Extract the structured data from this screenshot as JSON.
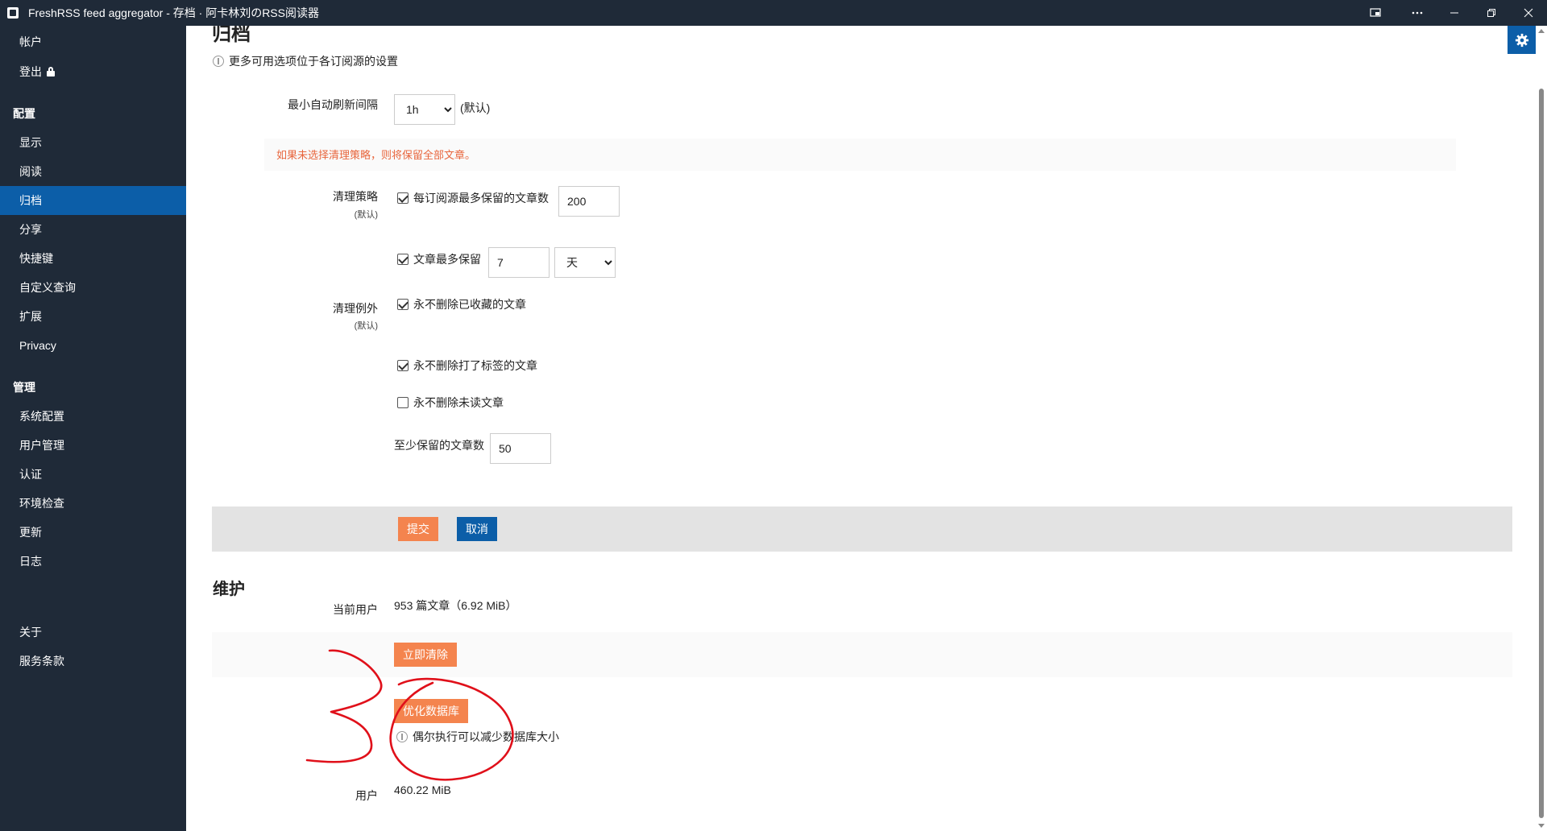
{
  "window": {
    "title": "FreshRSS feed aggregator - 存档 · 阿卡林刘のRSS阅读器"
  },
  "sidebar": {
    "account_items": [
      "帐户",
      "登出"
    ],
    "config_section": "配置",
    "config_items": [
      "显示",
      "阅读",
      "归档",
      "分享",
      "快捷键",
      "自定义查询",
      "扩展",
      "Privacy"
    ],
    "active_item": "归档",
    "admin_section": "管理",
    "admin_items": [
      "系统配置",
      "用户管理",
      "认证",
      "环境检查",
      "更新",
      "日志"
    ],
    "footer_items": [
      "关于",
      "服务条款"
    ]
  },
  "archive": {
    "heading": "归档",
    "more_options_hint": "更多可用选项位于各订阅源的设置",
    "refresh_label": "最小自动刷新间隔",
    "refresh_value": "1h",
    "refresh_default": "(默认)",
    "warning": "如果未选择清理策略，则将保留全部文章。",
    "cleanup_policy_label": "清理策略",
    "cleanup_policy_sub": "(默认)",
    "keep_max_label": "每订阅源最多保留的文章数",
    "keep_max_value": "200",
    "keep_max_checked": true,
    "keep_period_label": "文章最多保留",
    "keep_period_value": "7",
    "keep_period_unit": "天",
    "keep_period_checked": true,
    "exceptions_label": "清理例外",
    "exceptions_sub": "(默认)",
    "exception_favourites": "永不删除已收藏的文章",
    "exception_favourites_checked": true,
    "exception_labels": "永不删除打了标签的文章",
    "exception_labels_checked": true,
    "exception_unread": "永不删除未读文章",
    "exception_unread_checked": false,
    "min_keep_label": "至少保留的文章数",
    "min_keep_value": "50",
    "submit_label": "提交",
    "cancel_label": "取消"
  },
  "maintenance": {
    "heading": "维护",
    "current_user_label": "当前用户",
    "current_user_value": "953 篇文章（6.92 MiB）",
    "purge_label": "立即清除",
    "optimize_label": "优化数据库",
    "optimize_hint": "偶尔执行可以减少数据库大小",
    "user_label": "用户",
    "user_value": "460.22 MiB"
  },
  "annotation": {
    "number": "3",
    "color": "#e0101a"
  },
  "colors": {
    "sidebar_bg": "#1f2a38",
    "active_bg": "#0c5ea8",
    "orange": "#f4844e",
    "blue": "#0c5ea8",
    "warning": "#e8663d"
  }
}
